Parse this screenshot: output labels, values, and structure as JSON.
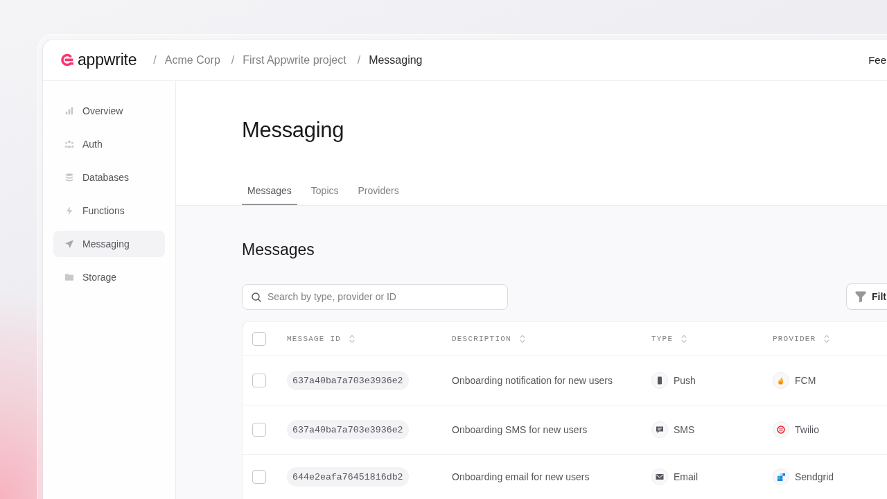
{
  "header": {
    "logo": {
      "text": "appwrite"
    },
    "breadcrumbs": [
      {
        "separator": "/",
        "label": "Acme Corp",
        "current": false
      },
      {
        "separator": "/",
        "label": "First Appwrite project",
        "current": false
      },
      {
        "separator": "/",
        "label": "Messaging",
        "current": true
      }
    ],
    "action": {
      "label": "Fee"
    }
  },
  "sidebar": {
    "items": [
      {
        "label": "Overview",
        "selected": false
      },
      {
        "label": "Auth",
        "selected": false
      },
      {
        "label": "Databases",
        "selected": false
      },
      {
        "label": "Functions",
        "selected": false
      },
      {
        "label": "Messaging",
        "selected": true
      },
      {
        "label": "Storage",
        "selected": false
      }
    ]
  },
  "page": {
    "title": "Messaging",
    "tabs": [
      {
        "label": "Messages",
        "selected": true
      },
      {
        "label": "Topics",
        "selected": false
      },
      {
        "label": "Providers",
        "selected": false
      }
    ]
  },
  "messages": {
    "title": "Messages",
    "search": {
      "placeholder": "Search by type, provider or ID"
    },
    "filter_button": {
      "label": "Filt"
    },
    "table": {
      "select_all": {
        "checked": false
      },
      "columns": [
        {
          "label": "MESSAGE ID"
        },
        {
          "label": "DESCRIPTION"
        },
        {
          "label": "TYPE"
        },
        {
          "label": "PROVIDER"
        }
      ],
      "rows": [
        {
          "checked": false,
          "message_id": "637a40ba7a703e3936e2",
          "description": "Onboarding notification for new users",
          "type": "Push",
          "provider": "FCM"
        },
        {
          "checked": false,
          "message_id": "637a40ba7a703e3936e2",
          "description": "Onboarding SMS for new users",
          "type": "SMS",
          "provider": "Twilio"
        },
        {
          "checked": false,
          "message_id": "644e2eafa76451816db2",
          "description": "Onboarding email for new users",
          "type": "Email",
          "provider": "Sendgrid"
        }
      ]
    }
  }
}
